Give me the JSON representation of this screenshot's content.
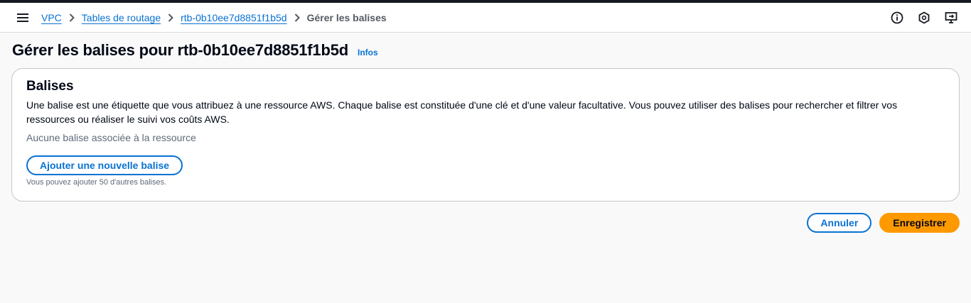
{
  "breadcrumb": {
    "items": [
      "VPC",
      "Tables de routage",
      "rtb-0b10ee7d8851f1b5d"
    ],
    "current": "Gérer les balises"
  },
  "header": {
    "title": "Gérer les balises pour rtb-0b10ee7d8851f1b5d",
    "info_label": "Infos"
  },
  "tags_panel": {
    "title": "Balises",
    "description": "Une balise est une étiquette que vous attribuez à une ressource AWS. Chaque balise est constituée d'une clé et d'une valeur facultative. Vous pouvez utiliser des balises pour rechercher et filtrer vos ressources ou réaliser le suivi vos coûts AWS.",
    "empty_text": "Aucune balise associée à la ressource",
    "add_button_label": "Ajouter une nouvelle balise",
    "remaining_hint": "Vous pouvez ajouter 50 d'autres balises."
  },
  "actions": {
    "cancel_label": "Annuler",
    "save_label": "Enregistrer"
  },
  "icons": {
    "menu": "hamburger-menu-icon",
    "info": "info-circle-icon",
    "notifications": "hexagon-icon",
    "feedback": "screen-share-icon"
  },
  "colors": {
    "link": "#0972d3",
    "primary": "#ff9900"
  }
}
